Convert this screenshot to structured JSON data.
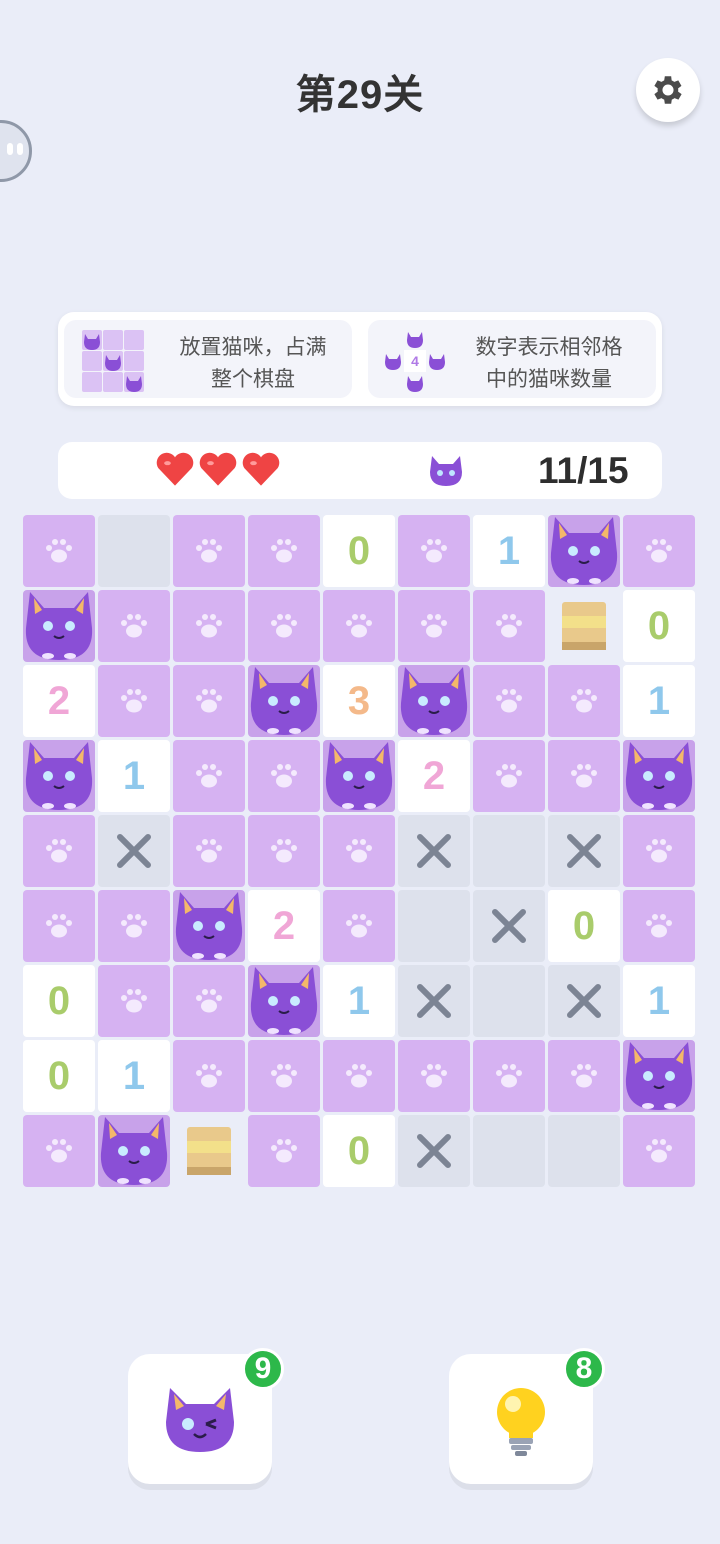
{
  "level_title": "第29关",
  "rules": [
    {
      "text": "放置猫咪，占满整个棋盘",
      "line1": "放置猫咪，占满",
      "line2": "整个棋盘",
      "mini_number": ""
    },
    {
      "text": "数字表示相邻格中的猫咪数量",
      "line1": "数字表示相邻格",
      "line2": "中的猫咪数量",
      "mini_number": "4"
    }
  ],
  "status": {
    "lives": 3,
    "cats_placed": "11/15"
  },
  "board": {
    "cols": 9,
    "rows": 9,
    "legend": {
      "p": "paw",
      "c": "cat",
      "x": "cross",
      "e": "empty",
      "b": "box",
      "digit": "number"
    },
    "cells": [
      [
        "p",
        "e",
        "p",
        "p",
        "0",
        "p",
        "1",
        "c",
        "p"
      ],
      [
        "c",
        "p",
        "p",
        "p",
        "p",
        "p",
        "p",
        "b",
        "0"
      ],
      [
        "2",
        "p",
        "p",
        "c",
        "3",
        "c",
        "p",
        "p",
        "1"
      ],
      [
        "c",
        "1",
        "p",
        "p",
        "c",
        "2",
        "p",
        "p",
        "c"
      ],
      [
        "p",
        "x",
        "p",
        "p",
        "p",
        "x",
        "e",
        "x",
        "p"
      ],
      [
        "p",
        "p",
        "c",
        "2",
        "p",
        "e",
        "x",
        "0",
        "p"
      ],
      [
        "0",
        "p",
        "p",
        "c",
        "1",
        "x",
        "e",
        "x",
        "1"
      ],
      [
        "0",
        "1",
        "p",
        "p",
        "p",
        "p",
        "p",
        "p",
        "c"
      ],
      [
        "p",
        "c",
        "b",
        "p",
        "0",
        "x",
        "e",
        "e",
        "p"
      ]
    ]
  },
  "number_colors": {
    "0": "#a9cc6b",
    "1": "#8fc8ec",
    "2": "#f0a6d6",
    "3": "#f4b98a"
  },
  "colors": {
    "paw_cell": "#d6b2f2",
    "cat_body": "#8a4fd6",
    "background": "#eaedf8"
  },
  "tools": {
    "cat_tool": {
      "icon": "wink-cat-icon",
      "count": "9"
    },
    "hint_tool": {
      "icon": "lightbulb-icon",
      "count": "8"
    }
  }
}
